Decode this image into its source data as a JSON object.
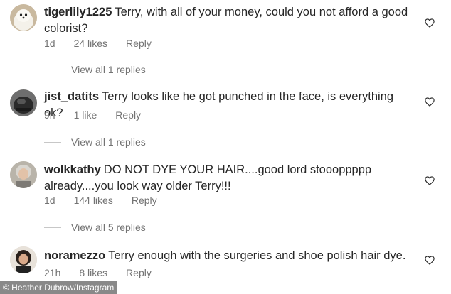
{
  "comments": [
    {
      "username": "tigerlily1225",
      "text": "Terry, with all of your money, could you not afford a good colorist?",
      "time": "1d",
      "likes": "24 likes",
      "reply_label": "Reply",
      "view_replies": "View all 1 replies",
      "avatar": "white-fluffy-dog"
    },
    {
      "username": "jist_datits",
      "text": "Terry looks like he got punched in the face, is everything ok?",
      "time": "9h",
      "likes": "1 like",
      "reply_label": "Reply",
      "view_replies": "View all 1 replies",
      "avatar": "dark-helmet"
    },
    {
      "username": "wolkkathy",
      "text": "DO NOT DYE YOUR HAIR....good lord stoooppppp already....you look way older Terry!!!",
      "time": "1d",
      "likes": "144 likes",
      "reply_label": "Reply",
      "view_replies": "View all 5 replies",
      "avatar": "gray-haired-woman"
    },
    {
      "username": "noramezzo",
      "text": "Terry enough with the surgeries and shoe polish hair dye.",
      "time": "21h",
      "likes": "8 likes",
      "reply_label": "Reply",
      "avatar": "dark-haired-woman"
    }
  ],
  "credit": "© Heather Dubrow/Instagram",
  "colors": {
    "text": "#262626",
    "secondary": "#737373",
    "divider": "#c7c7c7"
  },
  "icons": [
    "heart-icon"
  ]
}
